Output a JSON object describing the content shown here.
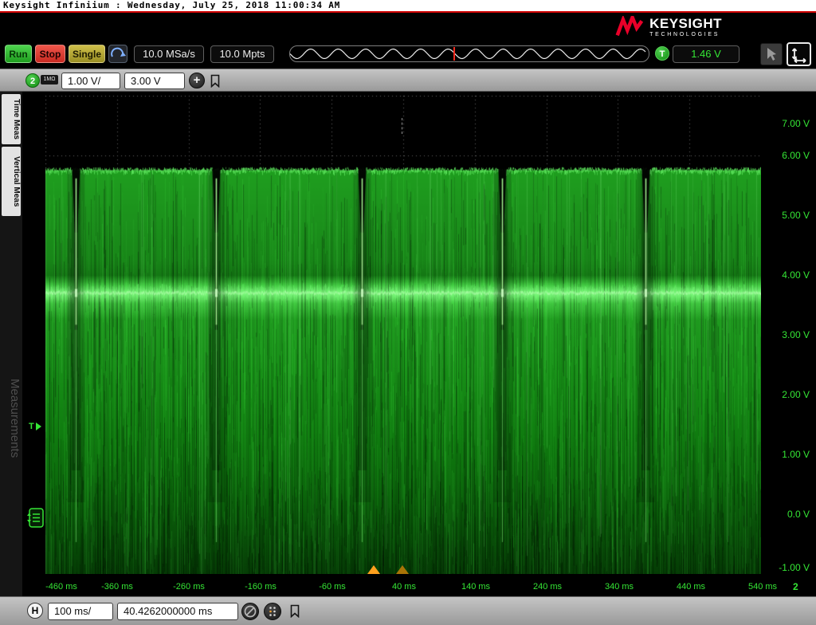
{
  "titlebar": {
    "text": "Keysight Infiniium : Wednesday, July 25, 2018 11:00:34 AM"
  },
  "brand": {
    "name": "KEYSIGHT",
    "sub": "TECHNOLOGIES"
  },
  "toolbar": {
    "run": "Run",
    "stop": "Stop",
    "single": "Single",
    "sample_rate": "10.0 MSa/s",
    "memory_depth": "10.0 Mpts",
    "trigger_symbol": "T",
    "trigger_level": "1.46 V"
  },
  "channel": {
    "number": "2",
    "impedance": "1MΩ",
    "scale": "1.00 V/",
    "offset": "3.00 V",
    "add_label": "+"
  },
  "sidebar": {
    "tabs": [
      "Time Meas",
      "Vertical Meas"
    ],
    "watermark": "Measurements"
  },
  "plot": {
    "y_ticks": [
      "7.00 V",
      "6.00 V",
      "5.00 V",
      "4.00 V",
      "3.00 V",
      "2.00 V",
      "1.00 V",
      "0.0 V",
      "-1.00 V"
    ],
    "x_ticks": [
      "-460 ms",
      "-360 ms",
      "-260 ms",
      "-160 ms",
      "-60 ms",
      "40 ms",
      "140 ms",
      "240 ms",
      "340 ms",
      "440 ms",
      "540 ms"
    ],
    "channel_marker": "2",
    "trigger_marker": "T",
    "waveform": {
      "type": "persistence-noise-trace",
      "y_range_v": [
        -1,
        7
      ],
      "x_range_ms": [
        -460,
        540
      ],
      "volts_per_div": 1.0,
      "ms_per_div": 100,
      "top_envelope_v": 5.75,
      "bottom_envelope_v": -1.0,
      "bright_band_v": 3.7,
      "dropout_times_ms": [
        -418,
        -222,
        -18,
        178,
        378
      ],
      "trigger_level_v": 1.46,
      "seed": 1234
    }
  },
  "bottombar": {
    "h_label": "H",
    "timebase": "100 ms/",
    "position": "40.4262000000 ms"
  },
  "colors": {
    "trace_green": "#2fbf2f",
    "axis_green": "#35e635",
    "brand_red": "#e90029",
    "run_green": "#2fb52f",
    "stop_red": "#dd3333",
    "single_yellow": "#b3a431",
    "marker_orange": "#ffa01e",
    "trigger_red": "#f22a1e"
  }
}
